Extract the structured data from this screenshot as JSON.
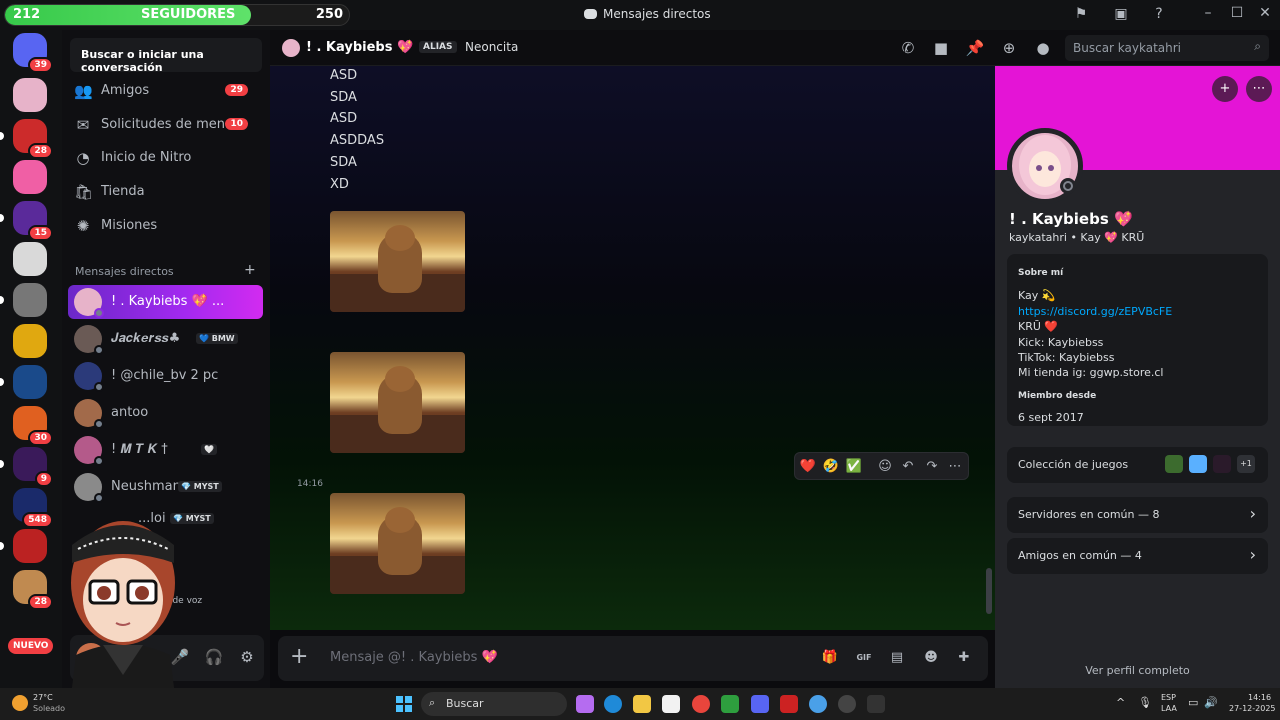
{
  "followers": {
    "current": "212",
    "label": "SEGUIDORES",
    "goal": "250",
    "progress": 0.848
  },
  "window": {
    "title": "Mensajes directos"
  },
  "servers": [
    {
      "name": "discord-home",
      "badge": "39"
    },
    {
      "name": "server-anime-girl",
      "badge": ""
    },
    {
      "name": "server-am",
      "badge": "28"
    },
    {
      "name": "server-pig",
      "badge": ""
    },
    {
      "name": "server-purple",
      "badge": "15"
    },
    {
      "name": "server-skull",
      "badge": ""
    },
    {
      "name": "server-gray",
      "badge": ""
    },
    {
      "name": "server-yellow",
      "badge": ""
    },
    {
      "name": "server-chile-m",
      "badge": ""
    },
    {
      "name": "server-orange",
      "badge": "30"
    },
    {
      "name": "server-dark",
      "badge": "9"
    },
    {
      "name": "server-blue",
      "badge": "548"
    },
    {
      "name": "server-club",
      "badge": ""
    },
    {
      "name": "server-dog",
      "badge": "28"
    }
  ],
  "nuevo_label": "NUEVO",
  "sidebar": {
    "search_label": "Buscar o iniciar una conversación",
    "nav": [
      {
        "label": "Amigos",
        "count": "29"
      },
      {
        "label": "Solicitudes de men...",
        "count": "10"
      },
      {
        "label": "Inicio de Nitro",
        "count": ""
      },
      {
        "label": "Tienda",
        "count": ""
      },
      {
        "label": "Misiones",
        "count": ""
      }
    ],
    "dm_header": "Mensajes directos",
    "dms": [
      {
        "name": "! . Kaybiebs 💖 ...",
        "tag": ""
      },
      {
        "name": "𝑱𝒂𝒄𝒌𝒆𝒓𝒔𝒔♣",
        "tag": "💙 BMW"
      },
      {
        "name": "! @chile_bv 2 pc",
        "tag": ""
      },
      {
        "name": "antoo",
        "tag": ""
      },
      {
        "name": "!     𝑴 𝑻 𝑲 †",
        "tag": "🤍"
      },
      {
        "name": "Neushman",
        "tag": "💎 MYST"
      },
      {
        "name": "...loi",
        "tag": "💎 MYST"
      },
      {
        "name": "...al de voz",
        "tag": ""
      }
    ]
  },
  "chat_header": {
    "name": "! . Kaybiebs 💖",
    "alias_label": "ALIAS",
    "alias_value": "Neoncita",
    "search_placeholder": "Buscar kaykatahri"
  },
  "messages": {
    "lines": [
      "ASD",
      "SDA",
      "ASD",
      "ASDDAS",
      "SDA",
      "XD"
    ],
    "timestamp": "14:16"
  },
  "reactions": [
    "❤️",
    "🤣",
    "✅"
  ],
  "composer": {
    "placeholder": "Mensaje @! . Kaybiebs 💖"
  },
  "profile": {
    "display_name": "! . Kaybiebs 💖",
    "sub": "kaykatahri • Kay  💖 KRŪ",
    "about_header": "Sobre mí",
    "about_lines": [
      "Kay 💫",
      "https://discord.gg/zEPVBcFE",
      "KRŪ ❤️",
      "Kick: Kaybiebss",
      "TikTok: Kaybiebss",
      "Mi tienda ig: ggwp.store.cl"
    ],
    "member_header": "Miembro desde",
    "member_since": "6 sept 2017",
    "games_label": "Colección de juegos",
    "games_more": "+1",
    "servers_common": "Servidores en común — 8",
    "friends_common": "Amigos en común — 4",
    "view_full": "Ver perfil completo"
  },
  "taskbar": {
    "temp": "27°C",
    "condition": "Soleado",
    "search": "Buscar",
    "lang1": "ESP",
    "lang2": "LAA",
    "time": "14:16",
    "date": "27-12-2025"
  },
  "colors": {
    "accent_purple": "#a329f0",
    "banner_magenta": "#e414d6",
    "badge_red": "#f23f43",
    "follow_green": "#37c94a",
    "link_blue": "#00a8fc"
  }
}
